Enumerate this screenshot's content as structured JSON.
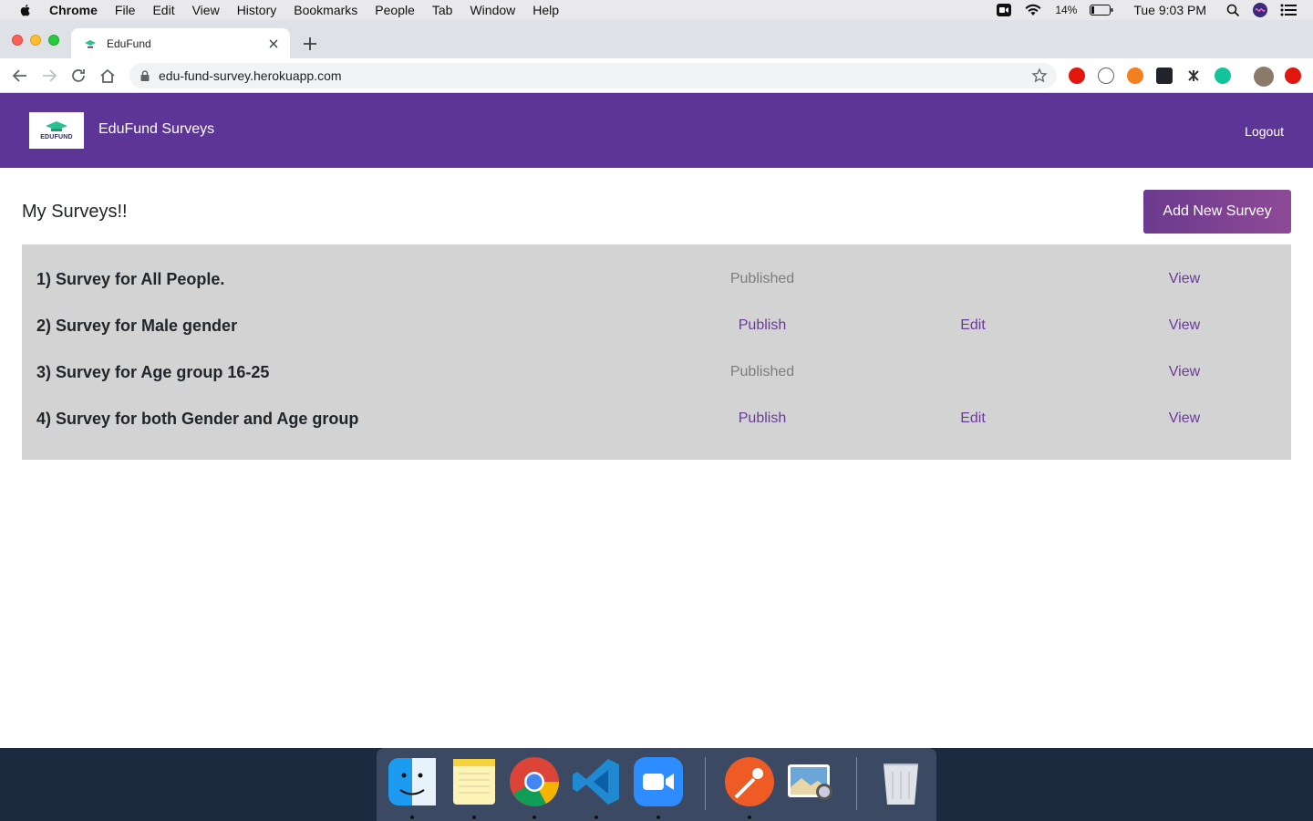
{
  "menubar": {
    "app_name": "Chrome",
    "items": [
      "File",
      "Edit",
      "View",
      "History",
      "Bookmarks",
      "People",
      "Tab",
      "Window",
      "Help"
    ],
    "battery": "14%",
    "clock": "Tue 9:03 PM"
  },
  "browser": {
    "tab_title": "EduFund",
    "url": "edu-fund-survey.herokuapp.com"
  },
  "app": {
    "logo_text": "EDUFUND",
    "brand": "EduFund Surveys",
    "logout": "Logout",
    "page_title": "My Surveys!!",
    "add_button": "Add New Survey",
    "colors": {
      "navbar": "#5c3596",
      "link": "#6a3a9a",
      "list_bg": "#d3d3d3"
    },
    "surveys": [
      {
        "name": "1) Survey for All People.",
        "status": "Published",
        "edit": "",
        "view": "View"
      },
      {
        "name": "2) Survey for Male gender",
        "status": "Publish",
        "edit": "Edit",
        "view": "View"
      },
      {
        "name": "3) Survey for Age group 16-25",
        "status": "Published",
        "edit": "",
        "view": "View"
      },
      {
        "name": "4) Survey for both Gender and Age group",
        "status": "Publish",
        "edit": "Edit",
        "view": "View"
      }
    ]
  },
  "dock": {
    "apps": [
      "finder-icon",
      "notes-icon",
      "chrome-icon",
      "vscode-icon",
      "zoom-icon",
      "postman-icon",
      "preview-icon",
      "trash-icon"
    ]
  }
}
